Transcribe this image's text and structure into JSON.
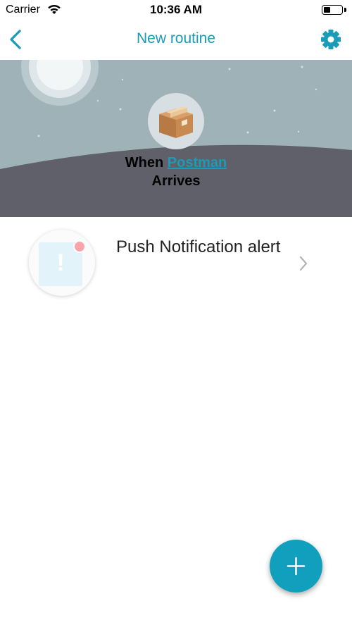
{
  "status_bar": {
    "carrier": "Carrier",
    "time": "10:36 AM",
    "wifi_icon": "wifi-icon",
    "battery_icon": "battery-icon",
    "battery_level": 0.4
  },
  "nav": {
    "title": "New routine",
    "back_icon": "chevron-left-icon",
    "settings_icon": "gear-icon"
  },
  "trigger": {
    "prefix": "When",
    "highlight": "Postman",
    "suffix": "Arrives",
    "icon": "package-icon"
  },
  "actions": [
    {
      "label": "Push Notification alert",
      "icon": "notification-alert-icon"
    }
  ],
  "fab": {
    "icon": "plus-icon"
  },
  "colors": {
    "accent": "#1a9cb9",
    "fab": "#109fbd",
    "sky": "#9eb2b8",
    "ground": "#5f6069",
    "notification_dot": "#f9a3ab"
  }
}
